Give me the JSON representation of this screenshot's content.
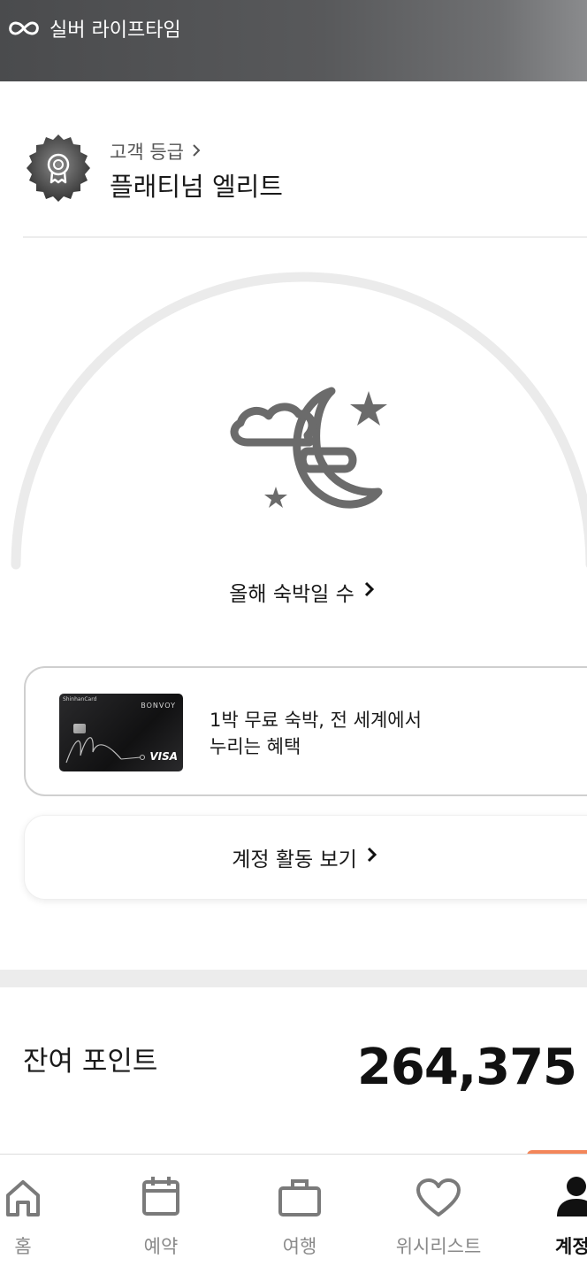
{
  "header": {
    "tier_name": "실버 라이프타임",
    "icon": "infinity-icon"
  },
  "grade": {
    "label": "고객 등급",
    "value": "플래티넘 엘리트",
    "badge_icon": "award-badge-icon"
  },
  "nights": {
    "label": "올해 숙박일 수",
    "icon": "moon-cloud-stars-icon"
  },
  "promo": {
    "line1": "1박 무료 숙박, 전 세계에서",
    "line2": "누리는 혜택",
    "card": {
      "issuer": "ShinhanCard",
      "brand": "BONVOY",
      "network": "VISA"
    }
  },
  "activity": {
    "label": "계정 활동 보기"
  },
  "points": {
    "label": "잔여 포인트",
    "value": "264,375"
  },
  "nav": {
    "items": [
      {
        "label": "홈",
        "icon": "home-icon"
      },
      {
        "label": "예약",
        "icon": "calendar-icon"
      },
      {
        "label": "여행",
        "icon": "suitcase-icon"
      },
      {
        "label": "위시리스트",
        "icon": "heart-icon"
      },
      {
        "label": "계정",
        "icon": "person-icon",
        "active": true
      }
    ]
  },
  "colors": {
    "header_gradient_start": "#4a4b4d",
    "header_gradient_end": "#8a8b8d",
    "accent_orange": "#f3865a",
    "icon_gray": "#6b6b6b"
  }
}
